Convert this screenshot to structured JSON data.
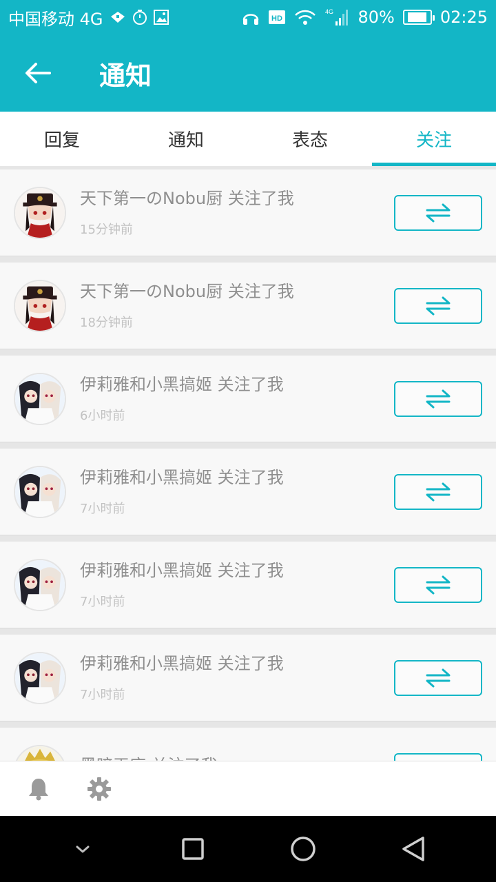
{
  "status_bar": {
    "carrier": "中国移动 4G",
    "network": "4G",
    "battery": "80%",
    "battery_level": 0.8,
    "time": "02:25",
    "icons": [
      "notification-icon",
      "timer-icon",
      "image-icon",
      "headphones-icon",
      "hd-icon",
      "wifi-icon",
      "signal-icon",
      "battery-icon"
    ]
  },
  "app_bar": {
    "title": "通知",
    "back_icon": "arrow-left-icon"
  },
  "tabs": [
    {
      "label": "回复",
      "active": false
    },
    {
      "label": "通知",
      "active": false
    },
    {
      "label": "表态",
      "active": false
    },
    {
      "label": "关注",
      "active": true
    }
  ],
  "notifications": [
    {
      "title": "天下第一のNobu厨 关注了我",
      "time": "15分钟前",
      "avatar": "red-hat-avatar"
    },
    {
      "title": "天下第一のNobu厨 关注了我",
      "time": "18分钟前",
      "avatar": "red-hat-avatar"
    },
    {
      "title": "伊莉雅和小黑搞姬 关注了我",
      "time": "6小时前",
      "avatar": "duo-avatar"
    },
    {
      "title": "伊莉雅和小黑搞姬 关注了我",
      "time": "7小时前",
      "avatar": "duo-avatar"
    },
    {
      "title": "伊莉雅和小黑搞姬 关注了我",
      "time": "7小时前",
      "avatar": "duo-avatar"
    },
    {
      "title": "伊莉雅和小黑搞姬 关注了我",
      "time": "7小时前",
      "avatar": "duo-avatar"
    },
    {
      "title": "黑暗王座 关注了我",
      "time": "",
      "avatar": "blonde-avatar"
    }
  ],
  "follow_button_icon": "mutual-follow-icon",
  "bottom_bar": {
    "icons": [
      "bell-icon",
      "gear-icon"
    ]
  },
  "nav_bar": {
    "icons": [
      "hide-icon",
      "recents-icon",
      "home-icon",
      "back-icon"
    ]
  },
  "colors": {
    "accent": "#13b6c6",
    "text_title": "#8e8e8e",
    "text_time": "#c2c2c2"
  }
}
